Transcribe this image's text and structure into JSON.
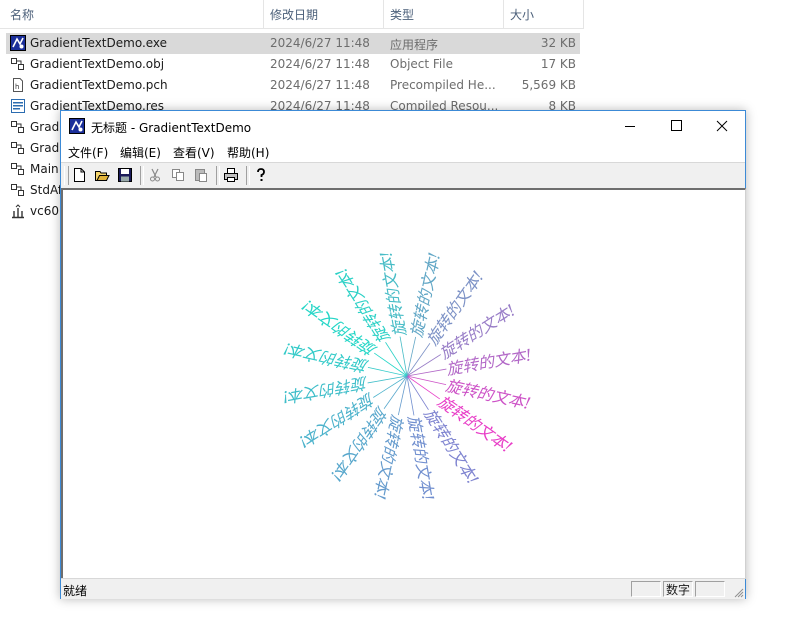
{
  "explorer": {
    "columns": {
      "name": "名称",
      "date": "修改日期",
      "type": "类型",
      "size": "大小"
    },
    "files": [
      {
        "name": "GradientTextDemo.exe",
        "date": "2024/6/27 11:48",
        "type": "应用程序",
        "size": "32 KB",
        "icon": "exe-icon"
      },
      {
        "name": "GradientTextDemo.obj",
        "date": "2024/6/27 11:48",
        "type": "Object File",
        "size": "17 KB",
        "icon": "obj-icon"
      },
      {
        "name": "GradientTextDemo.pch",
        "date": "2024/6/27 11:48",
        "type": "Precompiled He...",
        "size": "5,569 KB",
        "icon": "pch-icon"
      },
      {
        "name": "GradientTextDemo.res",
        "date": "2024/6/27 11:48",
        "type": "Compiled Resou...",
        "size": "8 KB",
        "icon": "res-icon"
      },
      {
        "name": "Grad",
        "date": "",
        "type": "",
        "size": "",
        "icon": "obj-icon"
      },
      {
        "name": "Grad",
        "date": "",
        "type": "",
        "size": "",
        "icon": "obj-icon"
      },
      {
        "name": "Main",
        "date": "",
        "type": "",
        "size": "",
        "icon": "obj-icon"
      },
      {
        "name": "StdAf",
        "date": "",
        "type": "",
        "size": "",
        "icon": "obj-icon"
      },
      {
        "name": "vc60.",
        "date": "",
        "type": "",
        "size": "",
        "icon": "idb-icon"
      }
    ]
  },
  "window": {
    "title": "无标题 - GradientTextDemo",
    "menu": [
      "文件(F)",
      "编辑(E)",
      "查看(V)",
      "帮助(H)"
    ],
    "toolbar": [
      "new-icon",
      "open-icon",
      "save-icon",
      "cut-icon",
      "copy-icon",
      "paste-icon",
      "print-icon",
      "help-icon"
    ],
    "status": {
      "text": "就绪",
      "num_indicator": "数字"
    }
  },
  "canvas": {
    "rotated_text": "旋转的文本!",
    "copies": 16,
    "step_degrees": 22.5,
    "colors": [
      "#e83ec7",
      "#1fdcc6",
      "#7e83d0"
    ]
  }
}
